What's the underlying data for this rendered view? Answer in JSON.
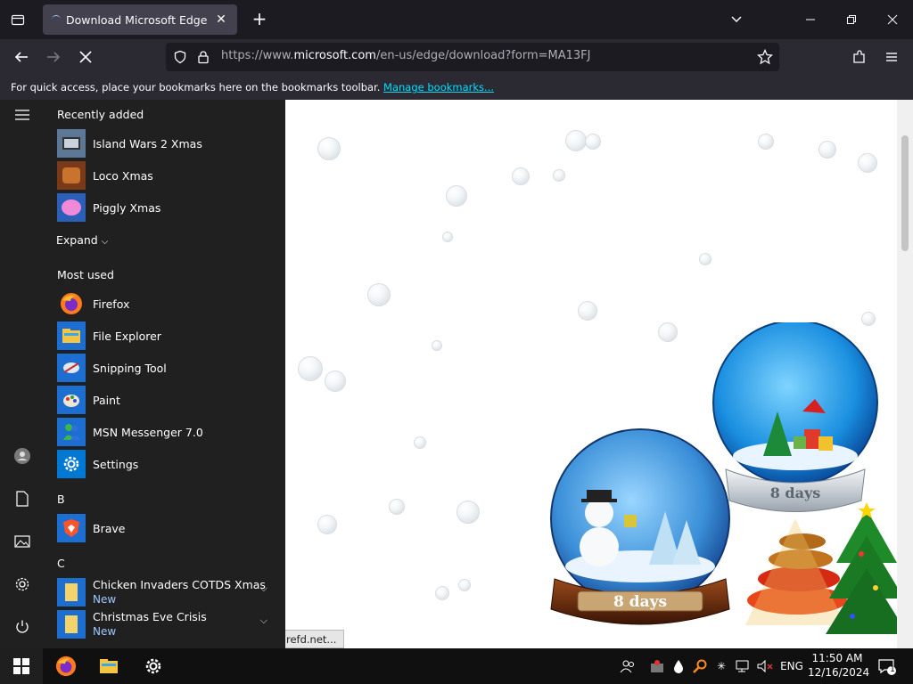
{
  "browser": {
    "tab_title": "Download Microsoft Edge",
    "url_prefix": "https://www.",
    "url_domain": "microsoft.com",
    "url_rest": "/en-us/edge/download?form=MA13FJ",
    "bookmark_text": "For quick access, place your bookmarks here on the bookmarks toolbar.",
    "bookmark_link": "Manage bookmarks...",
    "status_link": "refd.net..."
  },
  "start_menu": {
    "recently_added_title": "Recently added",
    "recent_apps": [
      {
        "label": "Island Wars 2 Xmas",
        "icon": "island-wars-icon",
        "color": "#8aa0b8"
      },
      {
        "label": "Loco Xmas",
        "icon": "loco-icon",
        "color": "#b06a2e"
      },
      {
        "label": "Piggly Xmas",
        "icon": "piggly-icon",
        "color": "#d86ac8"
      }
    ],
    "expand_label": "Expand",
    "most_used_title": "Most used",
    "most_used": [
      {
        "label": "Firefox",
        "icon": "firefox-icon"
      },
      {
        "label": "File Explorer",
        "icon": "file-explorer-icon"
      },
      {
        "label": "Snipping Tool",
        "icon": "snipping-tool-icon"
      },
      {
        "label": "Paint",
        "icon": "paint-icon"
      },
      {
        "label": "MSN Messenger 7.0",
        "icon": "msn-messenger-icon"
      },
      {
        "label": "Settings",
        "icon": "settings-icon"
      }
    ],
    "group_b": "B",
    "brave_label": "Brave",
    "group_c": "C",
    "c_apps": [
      {
        "label": "Chicken Invaders COTDS Xmas",
        "sub": "New"
      },
      {
        "label": "Christmas Eve Crisis",
        "sub": "New"
      }
    ]
  },
  "page": {
    "globe1_text": "8 days",
    "globe2_text": "8 days"
  },
  "taskbar": {
    "lang": "ENG",
    "time": "11:50 AM",
    "date": "12/16/2024",
    "notifications": "1"
  },
  "colors": {
    "accent": "#0078d4",
    "link": "#00ddff"
  }
}
